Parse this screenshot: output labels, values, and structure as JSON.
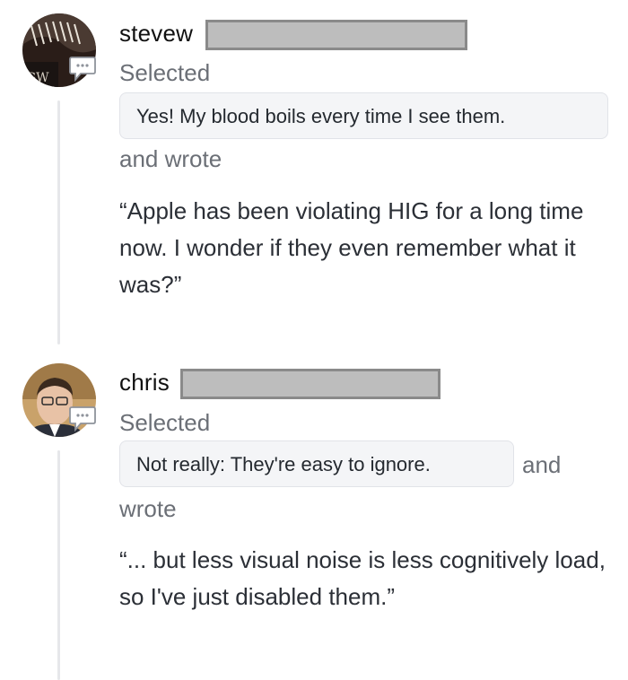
{
  "comments": [
    {
      "username": "stevew",
      "action": "Selected",
      "selected_option": "Yes! My blood boils every time I see them.",
      "wrote": "and wrote",
      "quote": "“Apple has been violating HIG for a long time now. I wonder if they even remember what it was?”",
      "avatar_text": "GW"
    },
    {
      "username": "chris",
      "action": "Selected",
      "selected_option": "Not really: They're easy to ignore.",
      "wrote_inline": "and",
      "wrote_rest": "wrote",
      "quote": "“... but less visual noise is less cognitively load, so I've just disabled them.”"
    }
  ],
  "colors": {
    "thread_line": "#e6e7ea",
    "chip_bg": "#f4f5f7",
    "muted_text": "#6b6f76"
  },
  "icons": {
    "comment_badge": "speech-bubble-icon"
  }
}
